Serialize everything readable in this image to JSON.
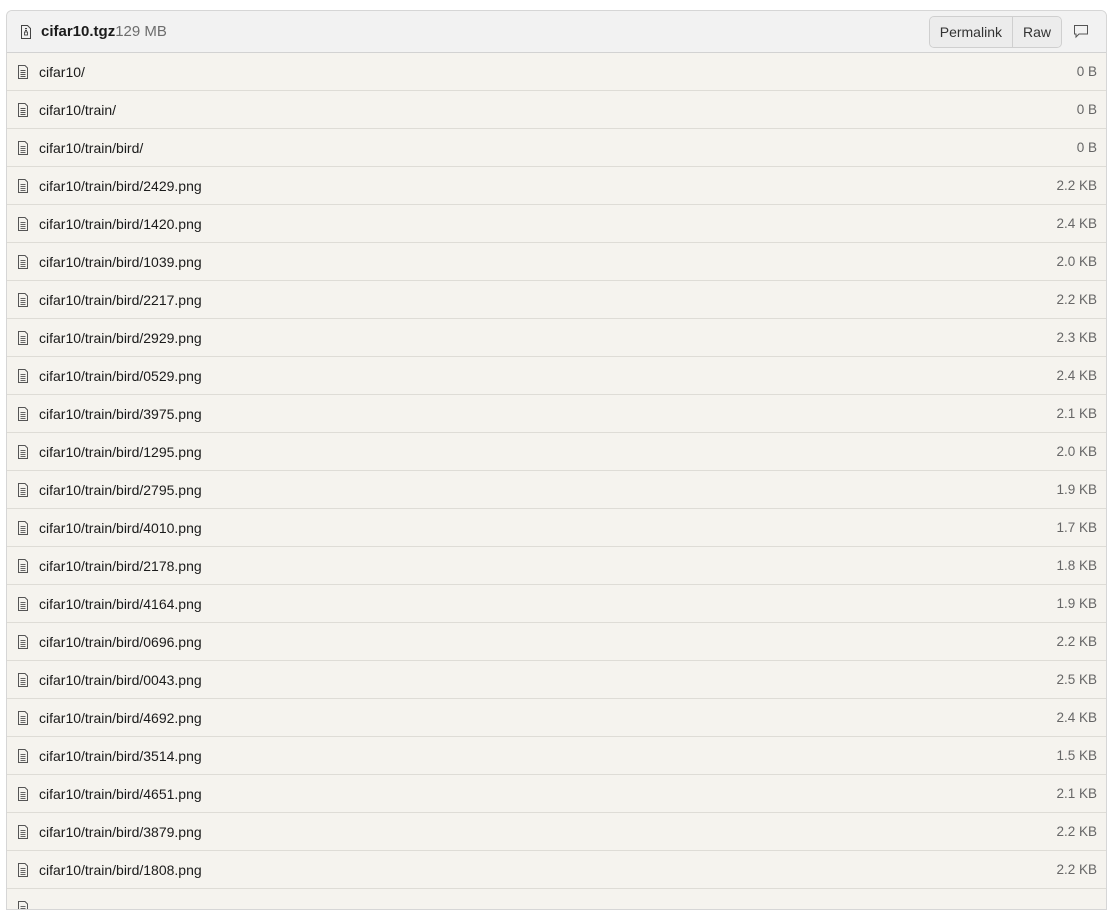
{
  "header": {
    "file_name": "cifar10.tgz",
    "file_size": "129 MB",
    "permalink_label": "Permalink",
    "raw_label": "Raw",
    "file_icon": "archive-file-icon",
    "comment_icon": "comment-icon"
  },
  "rows": [
    {
      "path": "cifar10/",
      "size": "0 B"
    },
    {
      "path": "cifar10/train/",
      "size": "0 B"
    },
    {
      "path": "cifar10/train/bird/",
      "size": "0 B"
    },
    {
      "path": "cifar10/train/bird/2429.png",
      "size": "2.2 KB"
    },
    {
      "path": "cifar10/train/bird/1420.png",
      "size": "2.4 KB"
    },
    {
      "path": "cifar10/train/bird/1039.png",
      "size": "2.0 KB"
    },
    {
      "path": "cifar10/train/bird/2217.png",
      "size": "2.2 KB"
    },
    {
      "path": "cifar10/train/bird/2929.png",
      "size": "2.3 KB"
    },
    {
      "path": "cifar10/train/bird/0529.png",
      "size": "2.4 KB"
    },
    {
      "path": "cifar10/train/bird/3975.png",
      "size": "2.1 KB"
    },
    {
      "path": "cifar10/train/bird/1295.png",
      "size": "2.0 KB"
    },
    {
      "path": "cifar10/train/bird/2795.png",
      "size": "1.9 KB"
    },
    {
      "path": "cifar10/train/bird/4010.png",
      "size": "1.7 KB"
    },
    {
      "path": "cifar10/train/bird/2178.png",
      "size": "1.8 KB"
    },
    {
      "path": "cifar10/train/bird/4164.png",
      "size": "1.9 KB"
    },
    {
      "path": "cifar10/train/bird/0696.png",
      "size": "2.2 KB"
    },
    {
      "path": "cifar10/train/bird/0043.png",
      "size": "2.5 KB"
    },
    {
      "path": "cifar10/train/bird/4692.png",
      "size": "2.4 KB"
    },
    {
      "path": "cifar10/train/bird/3514.png",
      "size": "1.5 KB"
    },
    {
      "path": "cifar10/train/bird/4651.png",
      "size": "2.1 KB"
    },
    {
      "path": "cifar10/train/bird/3879.png",
      "size": "2.2 KB"
    },
    {
      "path": "cifar10/train/bird/1808.png",
      "size": "2.2 KB"
    },
    {
      "path": "",
      "size": ""
    }
  ]
}
